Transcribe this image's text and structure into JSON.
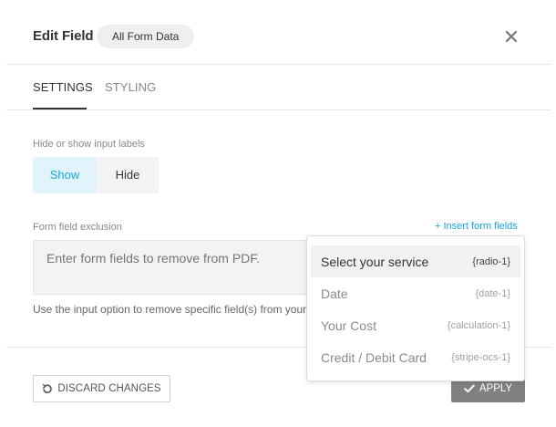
{
  "header": {
    "title": "Edit Field",
    "pill_label": "All Form Data"
  },
  "tabs": [
    {
      "label": "SETTINGS",
      "active": true
    },
    {
      "label": "STYLING",
      "active": false
    }
  ],
  "labels_section": {
    "label": "Hide or show input labels",
    "options": [
      "Show",
      "Hide"
    ],
    "selected": "Show"
  },
  "exclusion": {
    "label": "Form field exclusion",
    "insert_link": "+ Insert form fields",
    "placeholder": "Enter form fields to remove from PDF.",
    "help_text": "Use the input option to remove specific field(s) from your PDF."
  },
  "dropdown": {
    "items": [
      {
        "label": "Select your service",
        "tag": "{radio-1}",
        "active": true
      },
      {
        "label": "Date",
        "tag": "{date-1}",
        "active": false
      },
      {
        "label": "Your Cost",
        "tag": "{calculation-1}",
        "active": false
      },
      {
        "label": "Credit / Debit Card",
        "tag": "{stripe-ocs-1}",
        "active": false
      }
    ]
  },
  "footer": {
    "discard_label": "DISCARD CHANGES",
    "apply_label": "APPLY"
  },
  "colors": {
    "accent": "#17a8e3",
    "active_segment_bg": "#e1f4fc",
    "apply_bg": "#808080"
  },
  "icons": {
    "close": "close-icon",
    "discard": "undo-icon",
    "apply": "check-icon"
  }
}
